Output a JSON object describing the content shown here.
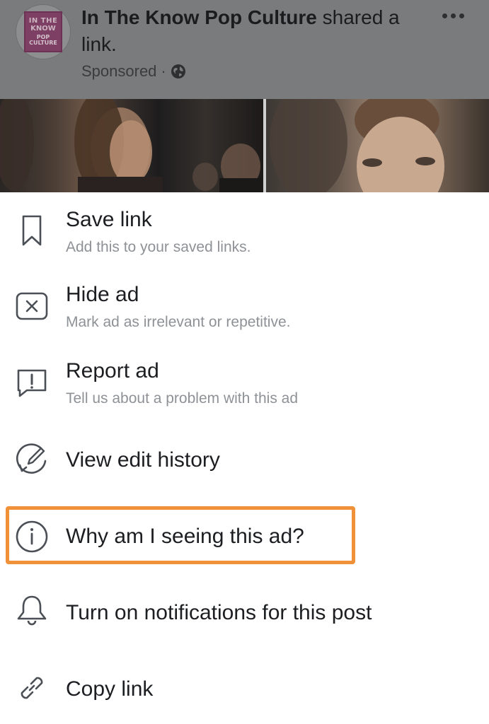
{
  "post": {
    "page_name": "In The Know Pop Culture",
    "action_text": " shared a link.",
    "sponsored": "Sponsored",
    "separator": "·",
    "avatar_logo": {
      "line1": "IN THE",
      "line2": "KNOW",
      "line3": "POP",
      "line4": "CULTURE"
    },
    "icons": {
      "globe": "globe-icon",
      "more": "more-options-icon"
    }
  },
  "menu": {
    "items": [
      {
        "label": "Save link",
        "sublabel": "Add this to your saved links.",
        "icon": "bookmark-icon"
      },
      {
        "label": "Hide ad",
        "sublabel": "Mark ad as irrelevant or repetitive.",
        "icon": "close-box-icon"
      },
      {
        "label": "Report ad",
        "sublabel": "Tell us about a problem with this ad",
        "icon": "report-icon"
      },
      {
        "label": "View edit history",
        "icon": "edit-history-icon"
      },
      {
        "label": "Why am I seeing this ad?",
        "icon": "info-icon"
      },
      {
        "label": "Turn on notifications for this post",
        "icon": "bell-icon"
      },
      {
        "label": "Copy link",
        "icon": "link-icon"
      }
    ]
  },
  "colors": {
    "highlight": "#f0913a",
    "overlay": "#7a7b7d",
    "text_primary": "#1c1e21",
    "text_secondary": "#8e9196"
  }
}
